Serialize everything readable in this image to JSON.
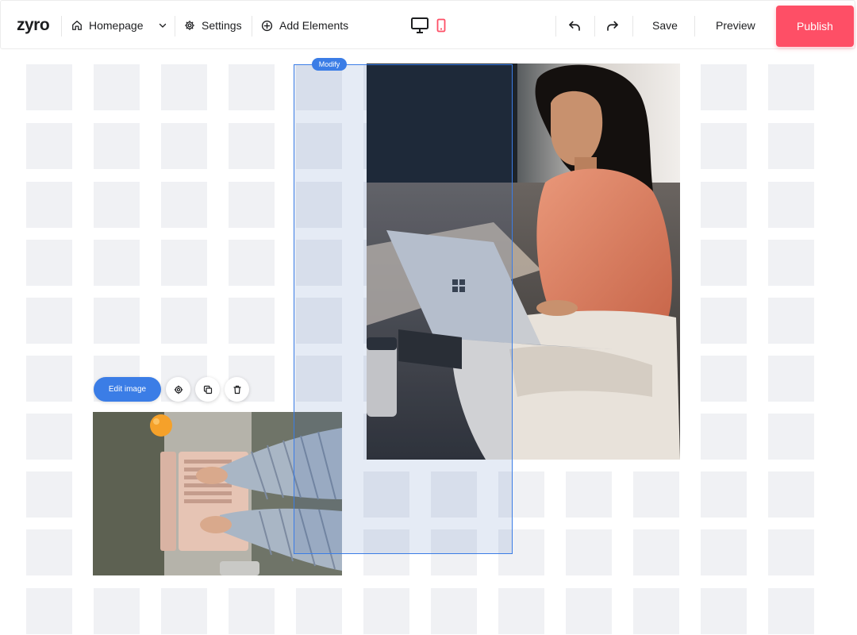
{
  "app": {
    "logo_text": "zyro"
  },
  "topbar": {
    "page_selector": {
      "label": "Homepage",
      "icon": "home-icon"
    },
    "settings": {
      "label": "Settings",
      "icon": "gear-icon"
    },
    "add_elements": {
      "label": "Add Elements",
      "icon": "plus-circle-icon"
    },
    "device_toggle": {
      "desktop_icon": "monitor-icon",
      "mobile_icon": "phone-icon",
      "active": "mobile"
    },
    "undo_icon": "undo-icon",
    "redo_icon": "redo-icon",
    "save_label": "Save",
    "preview_label": "Preview",
    "publish_label": "Publish"
  },
  "canvas": {
    "selection_badge": "Modify",
    "image_toolbar": {
      "edit_label": "Edit image",
      "settings_icon": "gear-icon",
      "duplicate_icon": "duplicate-icon",
      "delete_icon": "trash-icon"
    }
  },
  "colors": {
    "accent": "#3b7de6",
    "publish": "#fe4f66",
    "active_device": "#fe4f66",
    "grid_cell": "#f0f1f4"
  }
}
